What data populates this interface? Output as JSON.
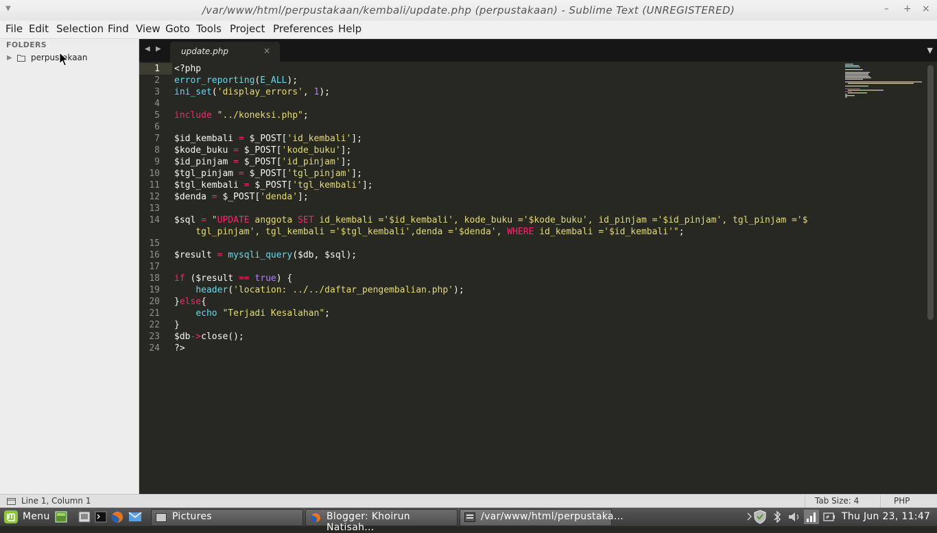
{
  "window": {
    "title": "/var/www/html/perpustakaan/kembali/update.php (perpustakaan) - Sublime Text (UNREGISTERED)",
    "controls": {
      "minimize": "–",
      "maximize": "+",
      "close": "×"
    }
  },
  "menu": [
    "File",
    "Edit",
    "Selection",
    "Find",
    "View",
    "Goto",
    "Tools",
    "Project",
    "Preferences",
    "Help"
  ],
  "sidebar": {
    "header": "FOLDERS",
    "folder": "perpustakaan"
  },
  "tab": {
    "label": "update.php",
    "close": "×"
  },
  "editor": {
    "lines": [
      {
        "n": "1",
        "tokens": [
          {
            "t": "<?php",
            "c": "w"
          }
        ]
      },
      {
        "n": "2",
        "tokens": [
          {
            "t": "error_reporting",
            "c": "f"
          },
          {
            "t": "(",
            "c": "w"
          },
          {
            "t": "E_ALL",
            "c": "f"
          },
          {
            "t": ");",
            "c": "w"
          }
        ]
      },
      {
        "n": "3",
        "tokens": [
          {
            "t": "ini_set",
            "c": "f"
          },
          {
            "t": "(",
            "c": "w"
          },
          {
            "t": "'display_errors'",
            "c": "s"
          },
          {
            "t": ", ",
            "c": "w"
          },
          {
            "t": "1",
            "c": "n"
          },
          {
            "t": ");",
            "c": "w"
          }
        ]
      },
      {
        "n": "4",
        "tokens": []
      },
      {
        "n": "5",
        "tokens": [
          {
            "t": "include",
            "c": "k"
          },
          {
            "t": " ",
            "c": "w"
          },
          {
            "t": "\"../koneksi.php\"",
            "c": "s"
          },
          {
            "t": ";",
            "c": "w"
          }
        ]
      },
      {
        "n": "6",
        "tokens": []
      },
      {
        "n": "7",
        "tokens": [
          {
            "t": "$id_kembali ",
            "c": "w"
          },
          {
            "t": "=",
            "c": "k"
          },
          {
            "t": " $_POST[",
            "c": "w"
          },
          {
            "t": "'id_kembali'",
            "c": "s"
          },
          {
            "t": "];",
            "c": "w"
          }
        ]
      },
      {
        "n": "8",
        "tokens": [
          {
            "t": "$kode_buku ",
            "c": "w"
          },
          {
            "t": "=",
            "c": "k"
          },
          {
            "t": " $_POST[",
            "c": "w"
          },
          {
            "t": "'kode_buku'",
            "c": "s"
          },
          {
            "t": "];",
            "c": "w"
          }
        ]
      },
      {
        "n": "9",
        "tokens": [
          {
            "t": "$id_pinjam ",
            "c": "w"
          },
          {
            "t": "=",
            "c": "k"
          },
          {
            "t": " $_POST[",
            "c": "w"
          },
          {
            "t": "'id_pinjam'",
            "c": "s"
          },
          {
            "t": "];",
            "c": "w"
          }
        ]
      },
      {
        "n": "10",
        "tokens": [
          {
            "t": "$tgl_pinjam ",
            "c": "w"
          },
          {
            "t": "=",
            "c": "k"
          },
          {
            "t": " $_POST[",
            "c": "w"
          },
          {
            "t": "'tgl_pinjam'",
            "c": "s"
          },
          {
            "t": "];",
            "c": "w"
          }
        ]
      },
      {
        "n": "11",
        "tokens": [
          {
            "t": "$tgl_kembali ",
            "c": "w"
          },
          {
            "t": "=",
            "c": "k"
          },
          {
            "t": " $_POST[",
            "c": "w"
          },
          {
            "t": "'tgl_kembali'",
            "c": "s"
          },
          {
            "t": "];",
            "c": "w"
          }
        ]
      },
      {
        "n": "12",
        "tokens": [
          {
            "t": "$denda ",
            "c": "w"
          },
          {
            "t": "=",
            "c": "k"
          },
          {
            "t": " $_POST[",
            "c": "w"
          },
          {
            "t": "'denda'",
            "c": "s"
          },
          {
            "t": "];",
            "c": "w"
          }
        ]
      },
      {
        "n": "13",
        "tokens": []
      },
      {
        "n": "14",
        "tokens": [
          {
            "t": "$sql ",
            "c": "w"
          },
          {
            "t": "=",
            "c": "k"
          },
          {
            "t": " ",
            "c": "w"
          },
          {
            "t": "\"",
            "c": "s"
          },
          {
            "t": "UPDATE",
            "c": "k"
          },
          {
            "t": " anggota ",
            "c": "s"
          },
          {
            "t": "SET",
            "c": "k"
          },
          {
            "t": " id_kembali ='$id_kembali', kode_buku ='$kode_buku', id_pinjam ='$id_pinjam', tgl_pinjam ='$",
            "c": "s"
          }
        ]
      },
      {
        "n": "",
        "tokens": [
          {
            "t": "    tgl_pinjam', tgl_kembali ='$tgl_kembali',denda ='$denda', ",
            "c": "s"
          },
          {
            "t": "WHERE",
            "c": "k"
          },
          {
            "t": " id_kembali ='$id_kembali'\"",
            "c": "s"
          },
          {
            "t": ";",
            "c": "w"
          }
        ]
      },
      {
        "n": "15",
        "tokens": []
      },
      {
        "n": "16",
        "tokens": [
          {
            "t": "$result ",
            "c": "w"
          },
          {
            "t": "=",
            "c": "k"
          },
          {
            "t": " ",
            "c": "w"
          },
          {
            "t": "mysqli_query",
            "c": "f"
          },
          {
            "t": "($db, $sql);",
            "c": "w"
          }
        ]
      },
      {
        "n": "17",
        "tokens": []
      },
      {
        "n": "18",
        "tokens": [
          {
            "t": "if",
            "c": "k"
          },
          {
            "t": " ($result ",
            "c": "w"
          },
          {
            "t": "==",
            "c": "k"
          },
          {
            "t": " ",
            "c": "w"
          },
          {
            "t": "true",
            "c": "n"
          },
          {
            "t": ") {",
            "c": "w"
          }
        ]
      },
      {
        "n": "19",
        "tokens": [
          {
            "t": "    ",
            "c": "w"
          },
          {
            "t": "header",
            "c": "f"
          },
          {
            "t": "(",
            "c": "w"
          },
          {
            "t": "'location: ../../daftar_pengembalian.php'",
            "c": "s"
          },
          {
            "t": ");",
            "c": "w"
          }
        ]
      },
      {
        "n": "20",
        "tokens": [
          {
            "t": "}",
            "c": "w"
          },
          {
            "t": "else",
            "c": "k"
          },
          {
            "t": "{",
            "c": "w"
          }
        ]
      },
      {
        "n": "21",
        "tokens": [
          {
            "t": "    ",
            "c": "w"
          },
          {
            "t": "echo",
            "c": "f"
          },
          {
            "t": " ",
            "c": "w"
          },
          {
            "t": "\"Terjadi Kesalahan\"",
            "c": "s"
          },
          {
            "t": ";",
            "c": "w"
          }
        ]
      },
      {
        "n": "22",
        "tokens": [
          {
            "t": "}",
            "c": "w"
          }
        ]
      },
      {
        "n": "23",
        "tokens": [
          {
            "t": "$db",
            "c": "w"
          },
          {
            "t": "->",
            "c": "k"
          },
          {
            "t": "close();",
            "c": "w"
          }
        ]
      },
      {
        "n": "24",
        "tokens": [
          {
            "t": "?>",
            "c": "w"
          }
        ]
      }
    ]
  },
  "statusbar": {
    "position": "Line 1, Column 1",
    "tab_size": "Tab Size: 4",
    "syntax": "PHP"
  },
  "taskbar": {
    "menu": "Menu",
    "windows": [
      "Pictures",
      "Blogger: Khoirun Natisah...",
      "/var/www/html/perpustaka..."
    ],
    "clock": "Thu Jun 23, 11:47"
  },
  "colors": {
    "editor_bg": "#272822",
    "keyword": "#f92672",
    "function": "#66d9ef",
    "string": "#e6db74",
    "number": "#ae81ff"
  }
}
